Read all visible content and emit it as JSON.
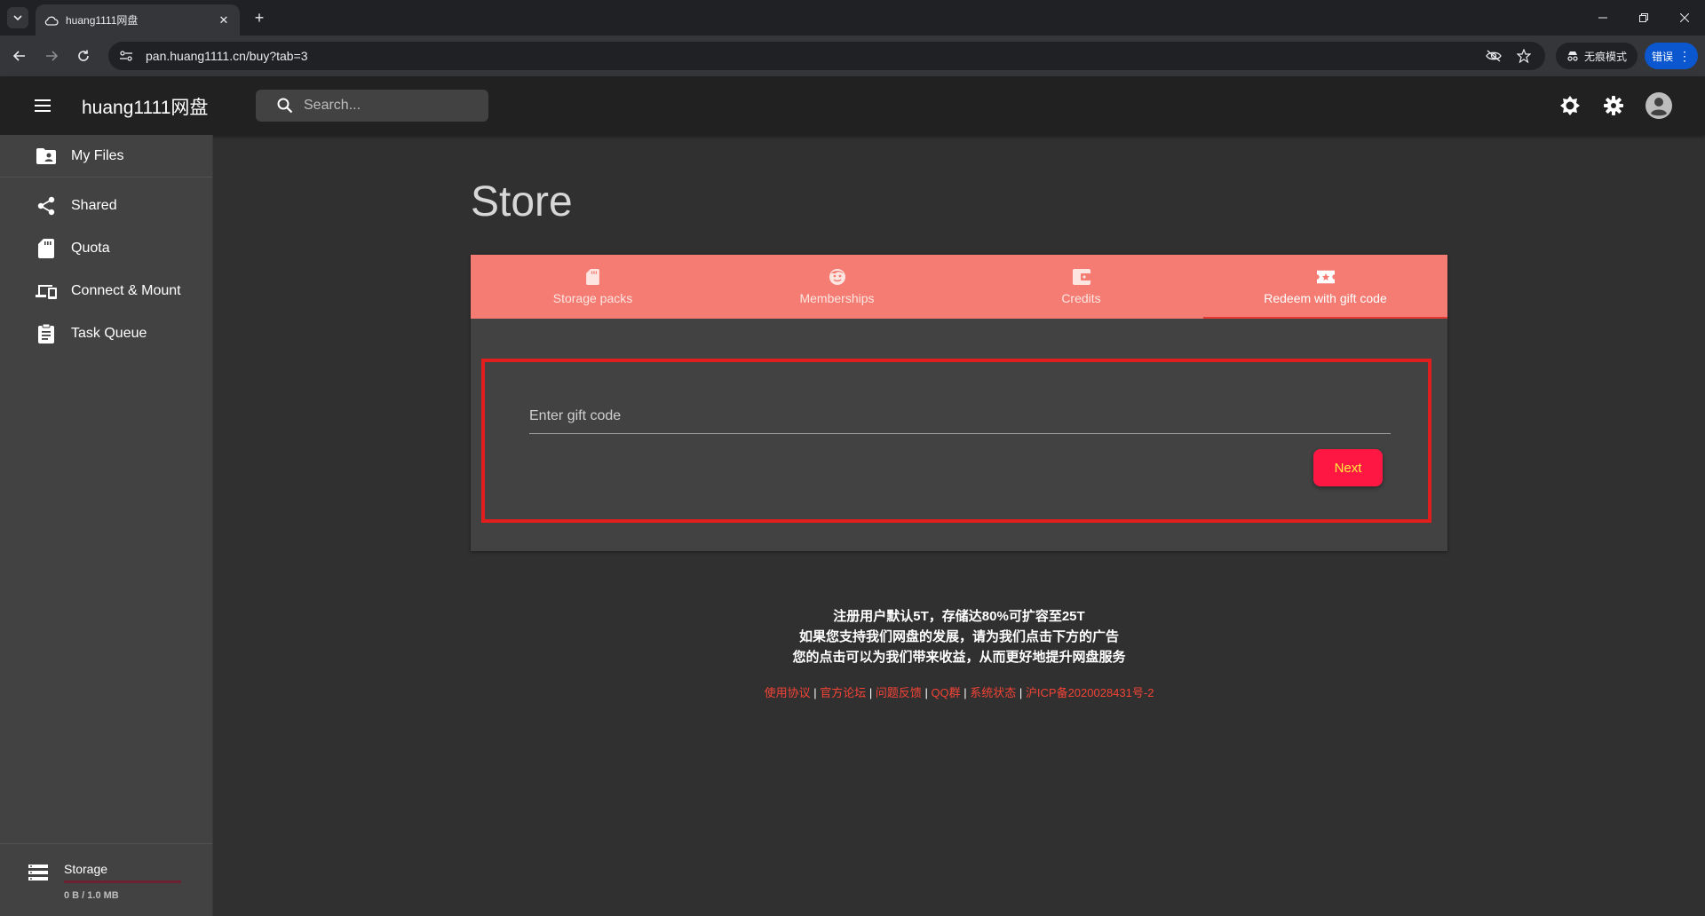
{
  "browser": {
    "tab_title": "huang1111网盘",
    "url": "pan.huang1111.cn/buy?tab=3",
    "incognito_label": "无痕模式",
    "error_label": "错误"
  },
  "app": {
    "title": "huang1111网盘",
    "search_placeholder": "Search..."
  },
  "sidebar": {
    "items": [
      {
        "label": "My Files",
        "icon": "folder-account-icon"
      },
      {
        "label": "Shared",
        "icon": "share-icon"
      },
      {
        "label": "Quota",
        "icon": "sd-card-icon"
      },
      {
        "label": "Connect & Mount",
        "icon": "devices-icon"
      },
      {
        "label": "Task Queue",
        "icon": "clipboard-icon"
      }
    ],
    "storage": {
      "label": "Storage",
      "value": "0 B / 1.0 MB",
      "used_fraction": 0
    }
  },
  "main": {
    "title": "Store",
    "tabs": [
      {
        "label": "Storage packs",
        "icon": "sd-card-icon"
      },
      {
        "label": "Memberships",
        "icon": "face-icon"
      },
      {
        "label": "Credits",
        "icon": "wallet-icon"
      },
      {
        "label": "Redeem with gift code",
        "icon": "ticket-icon"
      }
    ],
    "active_tab": 3,
    "gift_placeholder": "Enter gift code",
    "next_label": "Next"
  },
  "notice": {
    "line1": "注册用户默认5T，存储达80%可扩容至25T",
    "line2": "如果您支持我们网盘的发展，请为我们点击下方的广告",
    "line3": "您的点击可以为我们带来收益，从而更好地提升网盘服务"
  },
  "footer": {
    "links": [
      "使用协议",
      "官方论坛",
      "问题反馈",
      "QQ群",
      "系统状态",
      "沪ICP备2020028431号-2"
    ],
    "separator": " | "
  },
  "colors": {
    "accent": "#f47c72",
    "button": "#ff1744",
    "button_text": "#ffeb3b",
    "highlight": "#e01e1e",
    "link": "#f44336"
  }
}
